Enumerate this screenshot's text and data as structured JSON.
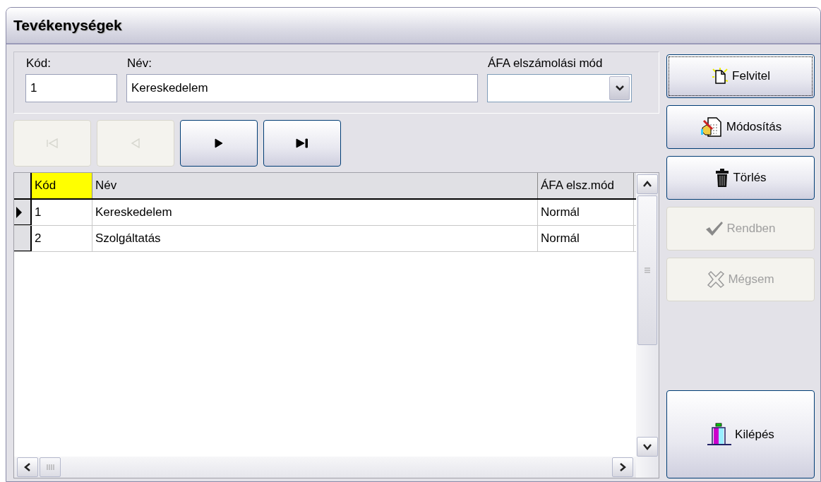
{
  "window": {
    "title": "Tevékenységek"
  },
  "fields": [
    {
      "kind": "text",
      "label": "Kód:",
      "value": "1"
    },
    {
      "kind": "text",
      "label": "Név:",
      "value": "Kereskedelem"
    },
    {
      "kind": "combo",
      "label": "ÁFA elszámolási mód"
    }
  ],
  "navigator": [
    {
      "kind": "first",
      "disabled": true
    },
    {
      "kind": "prev",
      "disabled": true
    },
    {
      "kind": "next",
      "disabled": false
    },
    {
      "kind": "last",
      "disabled": false
    }
  ],
  "table": {
    "columns": [
      {
        "label": "Kód",
        "highlighted": true
      },
      {
        "label": "Név",
        "highlighted": false
      },
      {
        "label": "ÁFA elsz.mód",
        "highlighted": false
      }
    ],
    "rows": [
      {
        "selected": true,
        "cells": [
          "1",
          "Kereskedelem",
          "Normál"
        ]
      },
      {
        "selected": false,
        "cells": [
          "2",
          "Szolgáltatás",
          "Normál"
        ]
      }
    ]
  },
  "actions": [
    {
      "kind": "new",
      "label": "Felvitel",
      "disabled": false,
      "focused": true
    },
    {
      "kind": "edit",
      "label": "Módosítás",
      "disabled": false,
      "focused": false
    },
    {
      "kind": "delete",
      "label": "Törlés",
      "disabled": false,
      "focused": false
    },
    {
      "kind": "ok",
      "label": "Rendben",
      "disabled": true,
      "focused": false
    },
    {
      "kind": "cancel",
      "label": "Mégsem",
      "disabled": true,
      "focused": false
    },
    {
      "kind": "exit",
      "label": "Kilépés",
      "disabled": false,
      "focused": false
    }
  ]
}
